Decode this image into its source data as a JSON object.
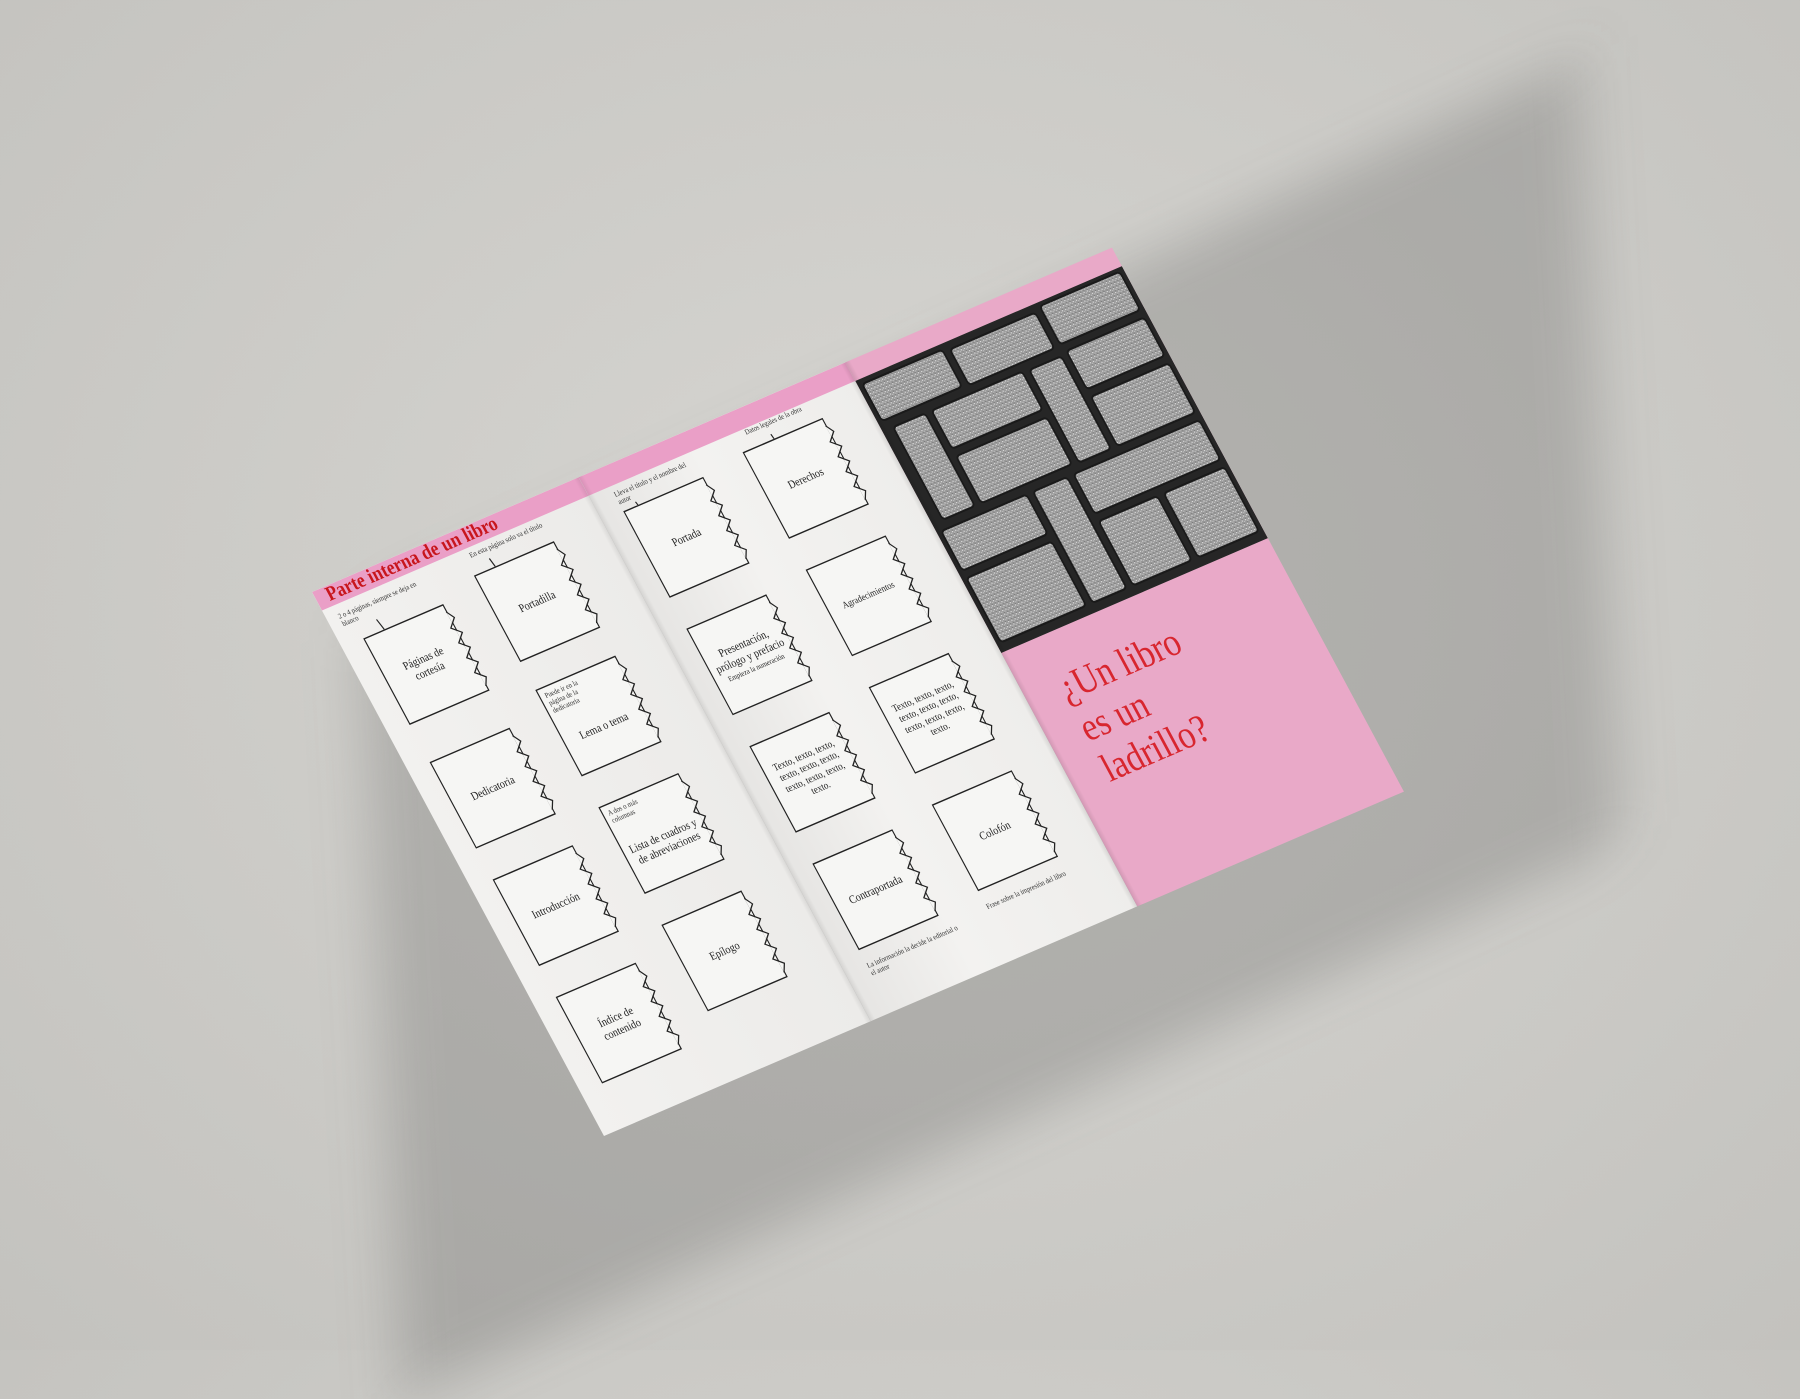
{
  "colors": {
    "pink": "#ea9fc7",
    "red": "#c8161d",
    "paper": "#f1f0ee",
    "background": "#cbcac6"
  },
  "panel1": {
    "heading": "Parte interna de un libro",
    "boxes": [
      {
        "label": "Páginas de cortesía",
        "note": "2 o 4 páginas, siempre se deja en blanco"
      },
      {
        "label": "Portadilla",
        "note": "En esta página solo va el título"
      },
      {
        "label": "Dedicatoria"
      },
      {
        "label": "Lema o tema",
        "note": "Puede ir en la página de la dedicatoria"
      },
      {
        "label": "Introducción"
      },
      {
        "label": "Lista de cuadros y de abreviaciones",
        "note": "A dos o más columnas"
      },
      {
        "label": "Índice de contenido"
      },
      {
        "label": "Epílogo"
      }
    ]
  },
  "panel2": {
    "boxes": [
      {
        "label": "Portada",
        "note": "Lleva el título y el nombre del autor"
      },
      {
        "label": "Derechos",
        "note": "Datos legales de la obra"
      },
      {
        "label": "Presentación, prólogo y prefacio",
        "sub": "Empieza la numeración"
      },
      {
        "label": "Agradecimientos"
      },
      {
        "label": "Texto, texto, texto, texto, texto, texto, texto, texto, texto, texto."
      },
      {
        "label": "Texto, texto, texto, texto, texto, texto, texto, texto, texto, texto."
      },
      {
        "label": "Contraportada",
        "note": "La información la decide la editorial o el autor"
      },
      {
        "label": "Colofón",
        "note": "Frase sobre la impresión del libro"
      }
    ]
  },
  "cover": {
    "title_lines": [
      "¿Un libro",
      "es un",
      "ladrillo?"
    ],
    "photo_icon": "brick-wall-photo"
  }
}
